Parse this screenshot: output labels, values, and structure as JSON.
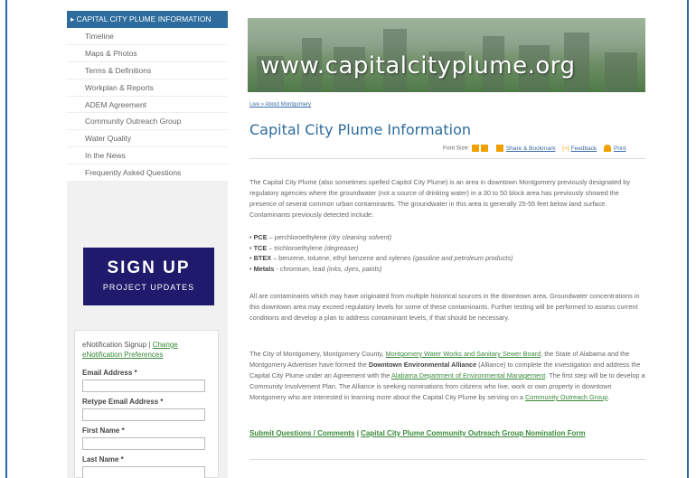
{
  "sidebar": {
    "head": "CAPITAL CITY PLUME INFORMATION",
    "items": [
      "Timeline",
      "Maps & Photos",
      "Terms & Definitions",
      "Workplan & Reports",
      "ADEM Agreement",
      "Community Outreach Group",
      "Water Quality",
      "In the News",
      "Frequently Asked Questions"
    ]
  },
  "signup": {
    "big": "SIGN UP",
    "small": "PROJECT UPDATES"
  },
  "form": {
    "note_prefix": "eNotification Signup | ",
    "note_link": "Change eNotification Preferences",
    "email_label": "Email Address *",
    "retype_label": "Retype Email Address *",
    "first_label": "First Name *",
    "last_label": "Last Name *"
  },
  "banner": {
    "url": "www.capitalcityplume.org"
  },
  "breadcrumb": "Live » About Montgomery",
  "title": "Capital City Plume Information",
  "tools": {
    "font_size": "Font Size:",
    "share": "Share & Bookmark",
    "feedback": "Feedback",
    "print": "Print"
  },
  "intro": "The Capital City Plume (also sometimes spelled Capitol City Plume) is an area in downtown Montgomery previously designated by regulatory agencies where the groundwater (not a source of drinking water) in a 30 to 50 block area has previously showed the presence of several common urban contaminants. The groundwater in this area is generally 25-55 feet below land surface. Contaminants previously detected include:",
  "contaminants": [
    {
      "name": "PCE",
      "desc": " – perchloroethylene ",
      "note": "(dry cleaning solvent)"
    },
    {
      "name": "TCE",
      "desc": " – trichloroethylene ",
      "note": "(degreaser)"
    },
    {
      "name": "BTEX",
      "desc": " – benzene, toluene, ethyl benzene and xylenes ",
      "note": "(gasoline and petroleum products)"
    },
    {
      "name": "Metals",
      "desc": " - chromium, lead ",
      "note": "(inks, dyes, paints)"
    }
  ],
  "para2": "All are contaminants which may have originated from multiple historical sources in the downtown area. Groundwater concentrations in this downtown area may exceed regulatory levels for some of these contaminants. Further testing will be performed to assess current conditions and develop a plan to address contaminant levels, if that should be necessary.",
  "para3": {
    "t1": "The City of Montgomery, Montgomery County, ",
    "l1": "Montgomery Water Works and Sanitary Sewer Board",
    "t2": ", the State of Alabama and the Montgomery Advertiser have formed the ",
    "b1": "Downtown Environmental Alliance",
    "t3": " (Alliance) to complete the investigation and address the Capital City Plume under an Agreement with the ",
    "l2": "Alabama Department of Environmental Management",
    "t4": ". The first step will be to develop a Community Involvement Plan. The Alliance is seeking nominations from citizens who live, work or own property in downtown Montgomery who are interested in learning more about the Capital City Plume by serving on a ",
    "l3": "Community Outreach Group",
    "t5": "."
  },
  "bottom": {
    "link1": "Submit Questions / Comments",
    "sep": " | ",
    "link2": "Capital City Plume Community Outreach Group Nomination Form"
  }
}
